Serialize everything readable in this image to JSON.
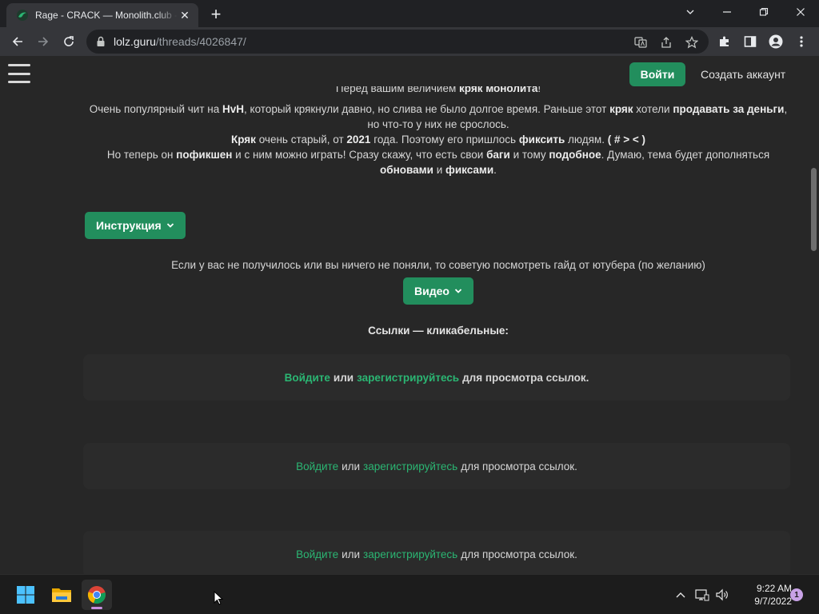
{
  "browser": {
    "tab_title": "Rage - CRACK — Monolith.club - Форум LOLZ",
    "url_host": "lolz.guru",
    "url_path": "/threads/4026847/"
  },
  "header": {
    "login_label": "Войти",
    "register_label": "Создать аккаунт"
  },
  "post": {
    "line0": {
      "a": "Перед вашим величием ",
      "b": "кряк монолита",
      "c": "!"
    },
    "line1": {
      "a": "Очень популярный чит на ",
      "b": "HvH",
      "c": ", который крякнули давно, но слива не было долгое время. Раньше этот ",
      "d": "кряк",
      "e": " хотели ",
      "f": "продавать за деньги",
      "g": ","
    },
    "line2": "но что-то у них не срослось.",
    "line3": {
      "a": "Кряк",
      "b": " очень старый, от ",
      "c": "2021",
      "d": " года. Поэтому его пришлось ",
      "e": "фиксить",
      "f": " людям. ",
      "g": "( # > < )"
    },
    "line4": {
      "a": "Но теперь он ",
      "b": "пофикшен",
      "c": " и с ним можно играть! Сразу скажу, что есть свои ",
      "d": "баги",
      "e": " и тому ",
      "f": "подобное",
      "g": ". Думаю, тема будет дополняться"
    },
    "line5": {
      "a": "обновами",
      "b": " и ",
      "c": "фиксами",
      "d": "."
    },
    "instruction_label": "Инструкция",
    "guide_text": "Если у вас не получилось или вы ничего не поняли, то советую посмотреть гайд от ютубера (по желанию)",
    "video_label": "Видео",
    "links_heading": "Ссылки — кликабельные:",
    "hidden_links": [
      {
        "login": "Войдите",
        "or": "или",
        "register": "зарегистрируйтесь",
        "rest": "для просмотра ссылок."
      },
      {
        "login": "Войдите",
        "or": "или",
        "register": "зарегистрируйтесь",
        "rest": "для просмотра ссылок."
      },
      {
        "login": "Войдите",
        "or": "или",
        "register": "зарегистрируйтесь",
        "rest": "для просмотра ссылок."
      }
    ]
  },
  "taskbar": {
    "time": "9:22 AM",
    "date": "9/7/2022",
    "notification_count": "1"
  },
  "colors": {
    "accent": "#228e5d",
    "link": "#2bb673",
    "page_bg": "#272727"
  }
}
